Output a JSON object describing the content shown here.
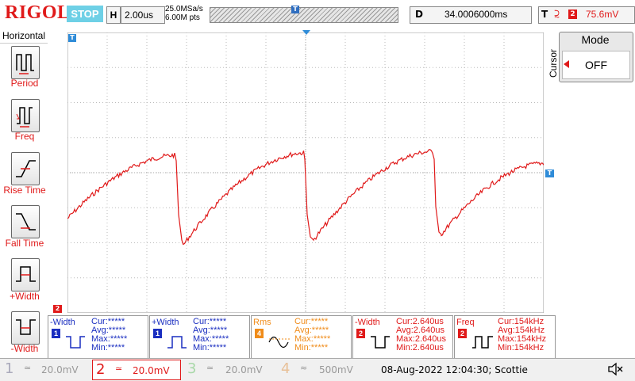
{
  "header": {
    "logo": "RIGOL",
    "run_state": "STOP",
    "horizontal_label": "H",
    "timebase": "2.00us",
    "sample_rate": "25.0MSa/s",
    "memory_depth": "6.00M pts",
    "trigger_pos_marker": "T",
    "delay_label": "D",
    "delay_value": "34.0006000ms",
    "trigger_label": "T",
    "trigger_edge": "⫈",
    "trigger_channel": "2",
    "trigger_level": "75.6mV"
  },
  "left_menu": {
    "title": "Horizontal",
    "items": [
      {
        "label": "Period",
        "icon": "period-icon"
      },
      {
        "label": "Freq",
        "icon": "freq-icon"
      },
      {
        "label": "Rise Time",
        "icon": "rise-time-icon"
      },
      {
        "label": "Fall Time",
        "icon": "fall-time-icon"
      },
      {
        "label": "+Width",
        "icon": "pos-width-icon"
      },
      {
        "label": "-Width",
        "icon": "neg-width-icon"
      }
    ]
  },
  "screen": {
    "marker_top_left": "T",
    "marker_right": "T",
    "ch2_ground_marker": "2",
    "trace_color": "#e01a1a"
  },
  "right_menu": {
    "side_label": "Cursor",
    "mode_title": "Mode",
    "mode_value": "OFF"
  },
  "measurements": [
    {
      "name": "-Width",
      "ch": "1",
      "ch_color": "#1a2ec0",
      "color": "#1a2ec0",
      "cur": "Cur:*****",
      "avg": "Avg:*****",
      "max": "Max:*****",
      "min": "Min:*****"
    },
    {
      "name": "+Width",
      "ch": "1",
      "ch_color": "#1a2ec0",
      "color": "#1a2ec0",
      "cur": "Cur:*****",
      "avg": "Avg:*****",
      "max": "Max:*****",
      "min": "Min:*****"
    },
    {
      "name": "Rms",
      "ch": "4",
      "ch_color": "#f08c1a",
      "color": "#f08c1a",
      "cur": "Cur:*****",
      "avg": "Avg:*****",
      "max": "Max:*****",
      "min": "Min:*****"
    },
    {
      "name": "-Width",
      "ch": "2",
      "ch_color": "#e01a1a",
      "color": "#e01a1a",
      "cur": "Cur:2.640us",
      "avg": "Avg:2.640us",
      "max": "Max:2.640us",
      "min": "Min:2.640us"
    },
    {
      "name": "Freq",
      "ch": "2",
      "ch_color": "#e01a1a",
      "color": "#e01a1a",
      "cur": "Cur:154kHz",
      "avg": "Avg:154kHz",
      "max": "Max:154kHz",
      "min": "Min:154kHz"
    }
  ],
  "channels": [
    {
      "num": "1",
      "coupling": "≃",
      "scale": "20.0mV"
    },
    {
      "num": "2",
      "coupling": "≃",
      "scale": "20.0mV"
    },
    {
      "num": "3",
      "coupling": "≃",
      "scale": "20.0mV"
    },
    {
      "num": "4",
      "coupling": "≈",
      "scale": "500mV"
    }
  ],
  "status": {
    "datetime": "08-Aug-2022 12:04:30; Scottie",
    "sound_icon": "speaker-muted-icon"
  }
}
